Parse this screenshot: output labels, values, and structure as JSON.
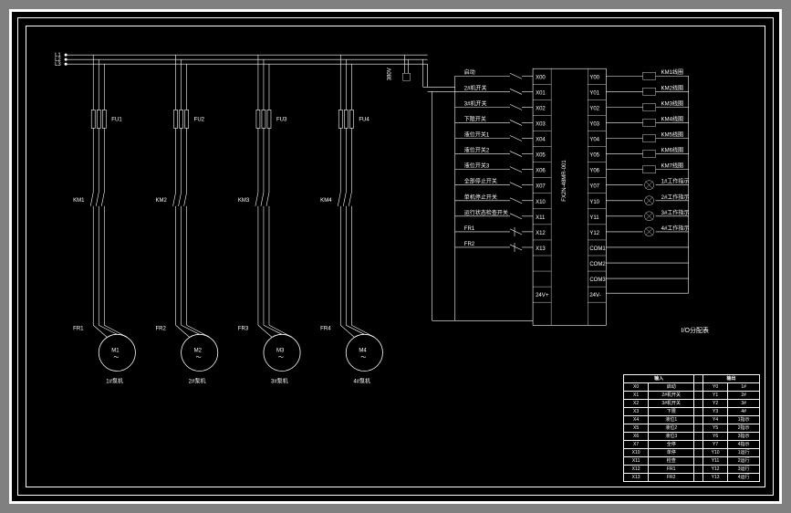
{
  "power": {
    "l1": "L1",
    "l2": "L2",
    "l3": "L3",
    "voltage": "380V"
  },
  "fuses": [
    "FU1",
    "FU2",
    "FU3",
    "FU4"
  ],
  "contactors": [
    "KM1",
    "KM2",
    "KM3",
    "KM4"
  ],
  "thermals": [
    "FR1",
    "FR2",
    "FR3",
    "FR4"
  ],
  "motors": [
    {
      "label": "M1",
      "name": "1#泵机"
    },
    {
      "label": "M2",
      "name": "2#泵机"
    },
    {
      "label": "M3",
      "name": "3#泵机"
    },
    {
      "label": "M4",
      "name": "4#泵机"
    }
  ],
  "plc_inputs": [
    {
      "name": "启动",
      "terminal": "X00"
    },
    {
      "name": "2#机开关",
      "terminal": "X01"
    },
    {
      "name": "3#机开关",
      "terminal": "X02"
    },
    {
      "name": "下限开关",
      "terminal": "X03"
    },
    {
      "name": "液位开关1",
      "terminal": "X04"
    },
    {
      "name": "液位开关2",
      "terminal": "X05"
    },
    {
      "name": "液位开关3",
      "terminal": "X06"
    },
    {
      "name": "全部停止开关",
      "terminal": "X07"
    },
    {
      "name": "单机停止开关",
      "terminal": "X10"
    },
    {
      "name": "运行状态检查开关",
      "terminal": "X11"
    },
    {
      "name": "FR1",
      "terminal": "X12"
    },
    {
      "name": "FR2",
      "terminal": "X13"
    }
  ],
  "plc_outputs": [
    {
      "name": "KM1线圈",
      "terminal": "Y00"
    },
    {
      "name": "KM2线圈",
      "terminal": "Y01"
    },
    {
      "name": "KM3线圈",
      "terminal": "Y02"
    },
    {
      "name": "KM4线圈",
      "terminal": "Y03"
    },
    {
      "name": "KM5线圈",
      "terminal": "Y04"
    },
    {
      "name": "KM6线圈",
      "terminal": "Y05"
    },
    {
      "name": "KM7线圈",
      "terminal": "Y06"
    },
    {
      "name": "1#工作指示",
      "terminal": "Y07"
    },
    {
      "name": "2#工作指示",
      "terminal": "Y10"
    },
    {
      "name": "3#工作指示",
      "terminal": "Y11"
    },
    {
      "name": "4#工作指示",
      "terminal": "Y12"
    }
  ],
  "plc_common": [
    "COM1",
    "COM2",
    "COM3"
  ],
  "plc_power": [
    "24V+",
    "24V-"
  ],
  "plc_model": "FX2N-48MR-001",
  "io_table": {
    "title": "I/O分配表",
    "headers": [
      "输入",
      "",
      "",
      "输出",
      ""
    ],
    "rows": [
      [
        "X0",
        "启动",
        "",
        "Y0",
        "1#"
      ],
      [
        "X1",
        "2#机开关",
        "",
        "Y1",
        "2#"
      ],
      [
        "X2",
        "3#机开关",
        "",
        "Y2",
        "3#"
      ],
      [
        "X3",
        "下限",
        "",
        "Y3",
        "4#"
      ],
      [
        "X4",
        "液位1",
        "",
        "Y4",
        "1指示"
      ],
      [
        "X5",
        "液位2",
        "",
        "Y5",
        "2指示"
      ],
      [
        "X6",
        "液位3",
        "",
        "Y6",
        "3指示"
      ],
      [
        "X7",
        "全停",
        "",
        "Y7",
        "4指示"
      ],
      [
        "X10",
        "单停",
        "",
        "Y10",
        "1运行"
      ],
      [
        "X11",
        "检查",
        "",
        "Y11",
        "2运行"
      ],
      [
        "X12",
        "FR1",
        "",
        "Y12",
        "3运行"
      ],
      [
        "X13",
        "FR2",
        "",
        "Y13",
        "4运行"
      ]
    ]
  }
}
